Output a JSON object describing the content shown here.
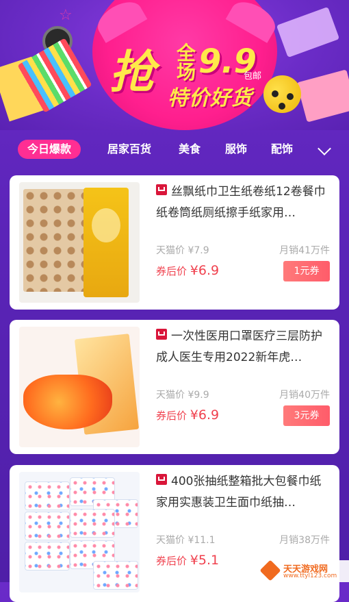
{
  "banner": {
    "qiang": "抢",
    "quanchang": "全场",
    "price": "9.9",
    "baoyou": "包邮",
    "tejia": "特价好货"
  },
  "tabs": [
    {
      "label": "今日爆款",
      "active": true
    },
    {
      "label": "居家百货"
    },
    {
      "label": "美食"
    },
    {
      "label": "服饰"
    },
    {
      "label": "配饰"
    }
  ],
  "products": [
    {
      "title": "丝飘纸巾卫生纸卷纸12卷餐巾纸卷筒纸厕纸擦手纸家用…",
      "orig_label": "天猫价 ¥7.9",
      "sold": "月销41万件",
      "final_label": "券后价 ",
      "final_price": "¥6.9",
      "coupon": "1元券"
    },
    {
      "title": "一次性医用口罩医疗三层防护成人医生专用2022新年虎…",
      "orig_label": "天猫价 ¥9.9",
      "sold": "月销40万件",
      "final_label": "券后价 ",
      "final_price": "¥6.9",
      "coupon": "3元券"
    },
    {
      "title": "400张抽纸整箱批大包餐巾纸家用实惠装卫生面巾纸抽…",
      "orig_label": "天猫价 ¥11.1",
      "sold": "月销38万件",
      "final_label": "券后价 ",
      "final_price": "¥5.1",
      "coupon": ""
    }
  ],
  "watermark": {
    "name": "天天游戏网",
    "url": "www.ttyl123.com"
  },
  "colors": {
    "background": "#5b24b8",
    "accent_pink": "#ff2e93",
    "price_red": "#f0414e",
    "coupon": "#ff5c6a"
  }
}
